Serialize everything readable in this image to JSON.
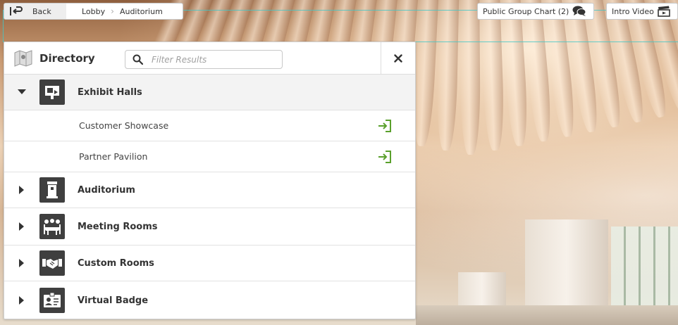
{
  "top_bar": {
    "back_label": "Back",
    "breadcrumbs": [
      "Lobby",
      "Auditorium"
    ],
    "chart_label": "Public Group Chart (2)",
    "video_label": "Intro Video"
  },
  "directory": {
    "title": "Directory",
    "search_placeholder": "Filter Results",
    "categories": [
      {
        "label": "Exhibit Halls",
        "icon": "booth-icon",
        "expanded": true,
        "items": [
          {
            "label": "Customer Showcase"
          },
          {
            "label": "Partner Pavilion"
          }
        ]
      },
      {
        "label": "Auditorium",
        "icon": "podium-icon",
        "expanded": false
      },
      {
        "label": "Meeting Rooms",
        "icon": "meeting-icon",
        "expanded": false
      },
      {
        "label": "Custom Rooms",
        "icon": "handshake-icon",
        "expanded": false
      },
      {
        "label": "Virtual Badge",
        "icon": "badge-icon",
        "expanded": false
      }
    ]
  },
  "colors": {
    "accent_green": "#5aa02c",
    "icon_dark": "#3f3f3f",
    "guide_cyan": "#40c8c8"
  }
}
